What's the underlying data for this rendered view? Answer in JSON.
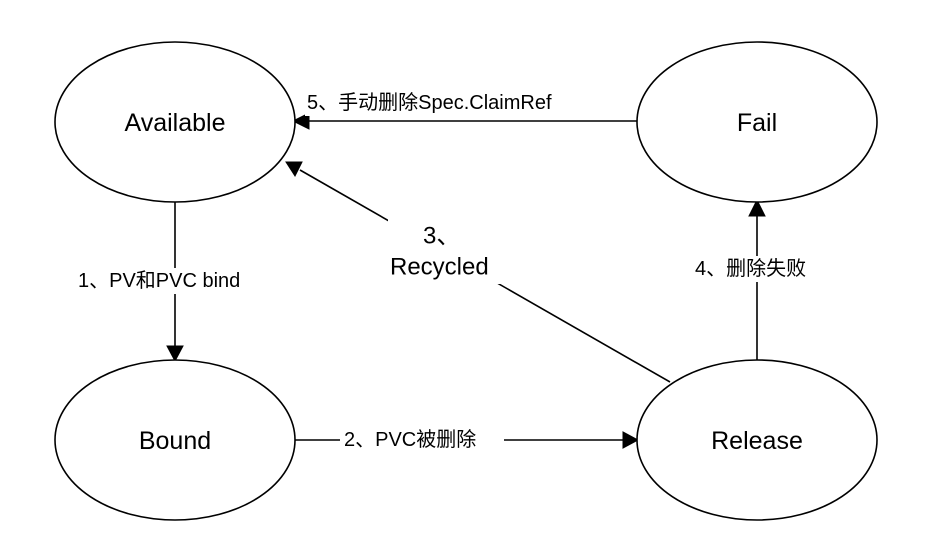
{
  "diagram": {
    "states": {
      "available": "Available",
      "fail": "Fail",
      "bound": "Bound",
      "release": "Release"
    },
    "transitions": {
      "bind": "1、PV和PVC bind",
      "pvc_deleted": "2、PVC被删除",
      "recycled_number": "3、",
      "recycled_text": "Recycled",
      "delete_failed": "4、删除失败",
      "manual_delete": "5、手动删除Spec.ClaimRef"
    },
    "colors": {
      "stroke": "#000000",
      "fill": "#ffffff",
      "text": "#000000"
    }
  }
}
